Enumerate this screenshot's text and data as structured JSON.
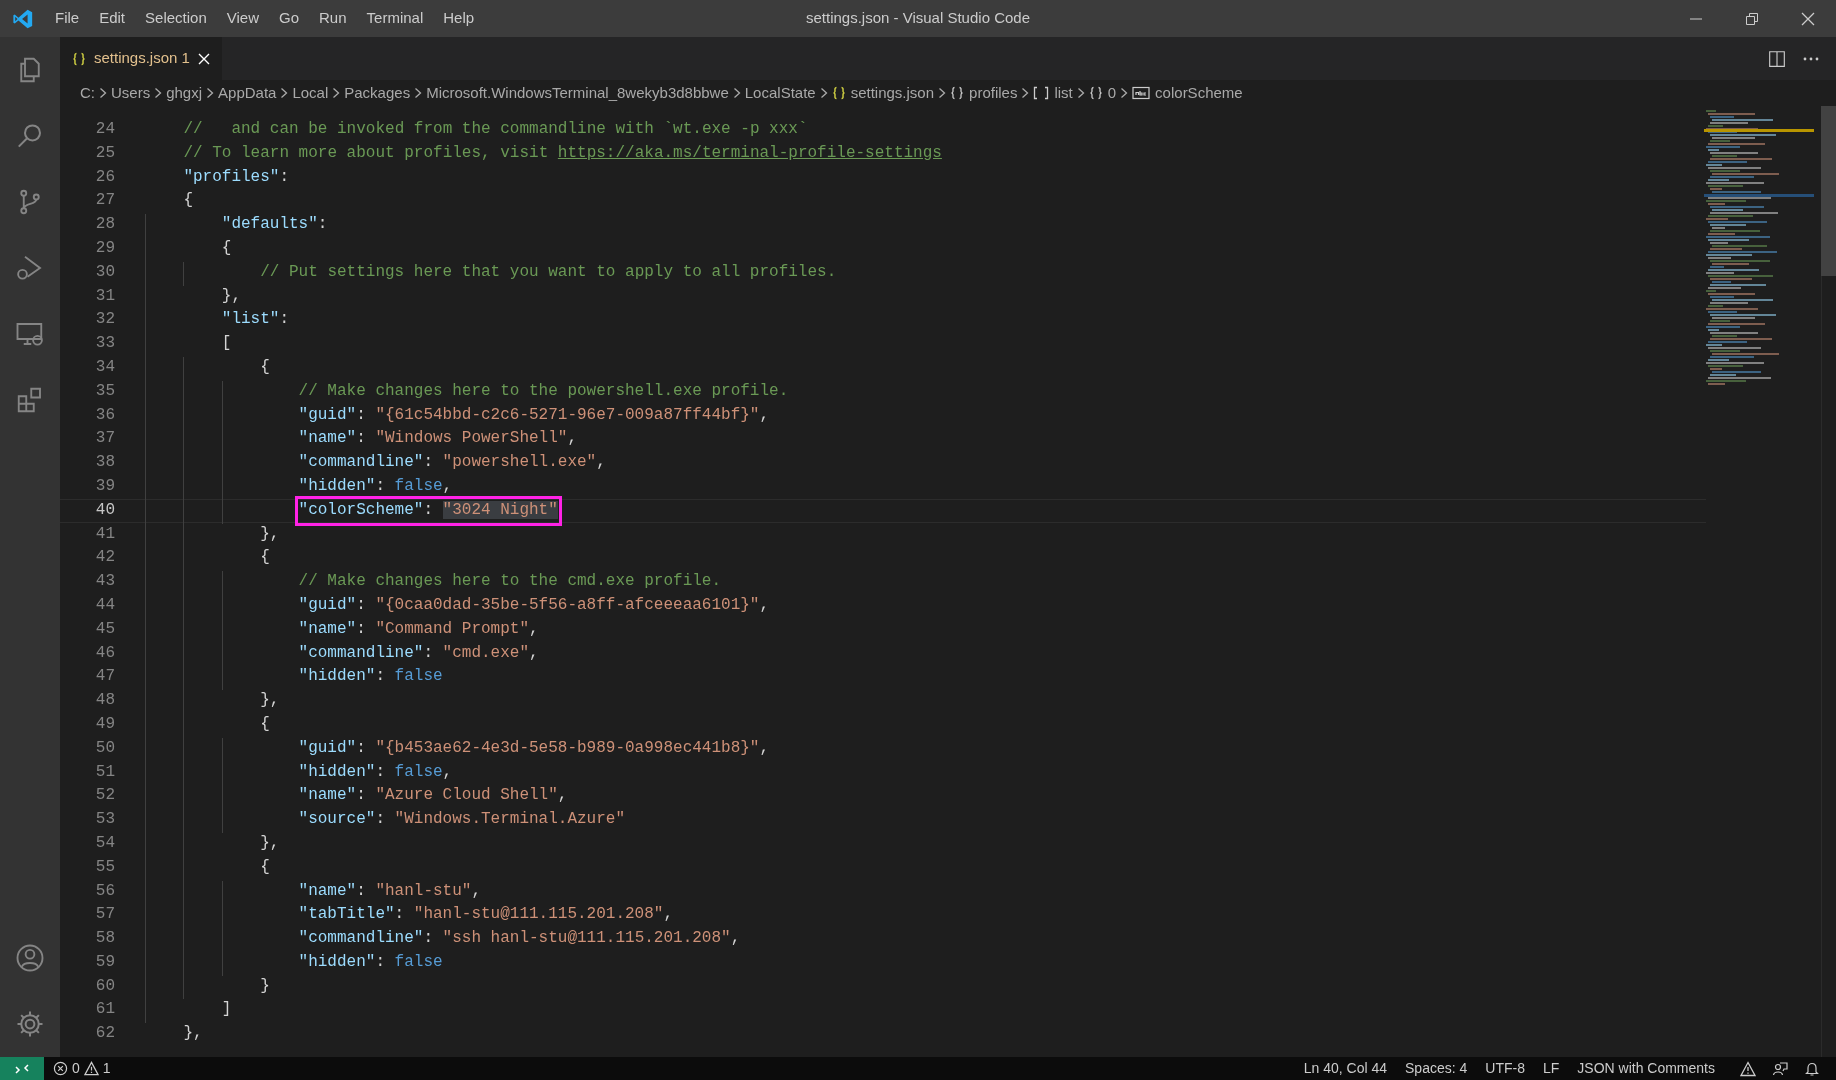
{
  "window": {
    "title": "settings.json - Visual Studio Code"
  },
  "menu": [
    "File",
    "Edit",
    "Selection",
    "View",
    "Go",
    "Run",
    "Terminal",
    "Help"
  ],
  "tabs": [
    {
      "label": "settings.json",
      "badge": "1",
      "selected": true
    }
  ],
  "breadcrumb": [
    {
      "label": "C:",
      "kind": "text"
    },
    {
      "label": "Users",
      "kind": "text"
    },
    {
      "label": "ghgxj",
      "kind": "text"
    },
    {
      "label": "AppData",
      "kind": "text"
    },
    {
      "label": "Local",
      "kind": "text"
    },
    {
      "label": "Packages",
      "kind": "text"
    },
    {
      "label": "Microsoft.WindowsTerminal_8wekyb3d8bbwe",
      "kind": "text"
    },
    {
      "label": "LocalState",
      "kind": "text"
    },
    {
      "label": "settings.json",
      "kind": "file"
    },
    {
      "label": "profiles",
      "kind": "object"
    },
    {
      "label": "list",
      "kind": "array"
    },
    {
      "label": "0",
      "kind": "object"
    },
    {
      "label": "colorScheme",
      "kind": "string"
    }
  ],
  "editor": {
    "lines": [
      {
        "number": "24",
        "current": false,
        "boxed": false,
        "tokens": [
          {
            "kind": "comment",
            "text": "    //   and can be invoked from the commandline with `wt.exe -p xxx`"
          }
        ]
      },
      {
        "number": "25",
        "current": false,
        "boxed": false,
        "tokens": [
          {
            "kind": "comment",
            "text": "    // To learn more about profiles, visit "
          },
          {
            "kind": "link",
            "text": "https://aka.ms/terminal-profile-settings"
          }
        ]
      },
      {
        "number": "26",
        "current": false,
        "boxed": false,
        "tokens": [
          {
            "kind": "key",
            "text": "    \"profiles\""
          },
          {
            "kind": "punct",
            "text": ":"
          }
        ]
      },
      {
        "number": "27",
        "current": false,
        "boxed": false,
        "tokens": [
          {
            "kind": "punct",
            "text": "    {"
          }
        ]
      },
      {
        "number": "28",
        "current": false,
        "boxed": false,
        "tokens": [
          {
            "kind": "key",
            "text": "        \"defaults\""
          },
          {
            "kind": "punct",
            "text": ":"
          }
        ]
      },
      {
        "number": "29",
        "current": false,
        "boxed": false,
        "tokens": [
          {
            "kind": "punct",
            "text": "        {"
          }
        ]
      },
      {
        "number": "30",
        "current": false,
        "boxed": false,
        "tokens": [
          {
            "kind": "comment",
            "text": "            // Put settings here that you want to apply to all profiles."
          }
        ]
      },
      {
        "number": "31",
        "current": false,
        "boxed": false,
        "tokens": [
          {
            "kind": "punct",
            "text": "        },"
          }
        ]
      },
      {
        "number": "32",
        "current": false,
        "boxed": false,
        "tokens": [
          {
            "kind": "key",
            "text": "        \"list\""
          },
          {
            "kind": "punct",
            "text": ":"
          }
        ]
      },
      {
        "number": "33",
        "current": false,
        "boxed": false,
        "tokens": [
          {
            "kind": "punct",
            "text": "        ["
          }
        ]
      },
      {
        "number": "34",
        "current": false,
        "boxed": false,
        "tokens": [
          {
            "kind": "punct",
            "text": "            {"
          }
        ]
      },
      {
        "number": "35",
        "current": false,
        "boxed": false,
        "tokens": [
          {
            "kind": "comment",
            "text": "                // Make changes here to the powershell.exe profile."
          }
        ]
      },
      {
        "number": "36",
        "current": false,
        "boxed": false,
        "tokens": [
          {
            "kind": "key",
            "text": "                \"guid\""
          },
          {
            "kind": "punct",
            "text": ": "
          },
          {
            "kind": "string",
            "text": "\"{61c54bbd-c2c6-5271-96e7-009a87ff44bf}\""
          },
          {
            "kind": "punct",
            "text": ","
          }
        ]
      },
      {
        "number": "37",
        "current": false,
        "boxed": false,
        "tokens": [
          {
            "kind": "key",
            "text": "                \"name\""
          },
          {
            "kind": "punct",
            "text": ": "
          },
          {
            "kind": "string",
            "text": "\"Windows PowerShell\""
          },
          {
            "kind": "punct",
            "text": ","
          }
        ]
      },
      {
        "number": "38",
        "current": false,
        "boxed": false,
        "tokens": [
          {
            "kind": "key",
            "text": "                \"commandline\""
          },
          {
            "kind": "punct",
            "text": ": "
          },
          {
            "kind": "string",
            "text": "\"powershell.exe\""
          },
          {
            "kind": "punct",
            "text": ","
          }
        ]
      },
      {
        "number": "39",
        "current": false,
        "boxed": false,
        "tokens": [
          {
            "kind": "key",
            "text": "                \"hidden\""
          },
          {
            "kind": "punct",
            "text": ": "
          },
          {
            "kind": "bool",
            "text": "false"
          },
          {
            "kind": "punct",
            "text": ","
          }
        ]
      },
      {
        "number": "40",
        "current": true,
        "boxed": true,
        "tokens": [
          {
            "kind": "key",
            "text": "                \"colorScheme\""
          },
          {
            "kind": "punct",
            "text": ": "
          },
          {
            "kind": "string-selected",
            "text": "\"3024 Night\""
          }
        ]
      },
      {
        "number": "41",
        "current": false,
        "boxed": false,
        "tokens": [
          {
            "kind": "punct",
            "text": "            },"
          }
        ]
      },
      {
        "number": "42",
        "current": false,
        "boxed": false,
        "tokens": [
          {
            "kind": "punct",
            "text": "            {"
          }
        ]
      },
      {
        "number": "43",
        "current": false,
        "boxed": false,
        "tokens": [
          {
            "kind": "comment",
            "text": "                // Make changes here to the cmd.exe profile."
          }
        ]
      },
      {
        "number": "44",
        "current": false,
        "boxed": false,
        "tokens": [
          {
            "kind": "key",
            "text": "                \"guid\""
          },
          {
            "kind": "punct",
            "text": ": "
          },
          {
            "kind": "string",
            "text": "\"{0caa0dad-35be-5f56-a8ff-afceeeaa6101}\""
          },
          {
            "kind": "punct",
            "text": ","
          }
        ]
      },
      {
        "number": "45",
        "current": false,
        "boxed": false,
        "tokens": [
          {
            "kind": "key",
            "text": "                \"name\""
          },
          {
            "kind": "punct",
            "text": ": "
          },
          {
            "kind": "string",
            "text": "\"Command Prompt\""
          },
          {
            "kind": "punct",
            "text": ","
          }
        ]
      },
      {
        "number": "46",
        "current": false,
        "boxed": false,
        "tokens": [
          {
            "kind": "key",
            "text": "                \"commandline\""
          },
          {
            "kind": "punct",
            "text": ": "
          },
          {
            "kind": "string",
            "text": "\"cmd.exe\""
          },
          {
            "kind": "punct",
            "text": ","
          }
        ]
      },
      {
        "number": "47",
        "current": false,
        "boxed": false,
        "tokens": [
          {
            "kind": "key",
            "text": "                \"hidden\""
          },
          {
            "kind": "punct",
            "text": ": "
          },
          {
            "kind": "bool",
            "text": "false"
          }
        ]
      },
      {
        "number": "48",
        "current": false,
        "boxed": false,
        "tokens": [
          {
            "kind": "punct",
            "text": "            },"
          }
        ]
      },
      {
        "number": "49",
        "current": false,
        "boxed": false,
        "tokens": [
          {
            "kind": "punct",
            "text": "            {"
          }
        ]
      },
      {
        "number": "50",
        "current": false,
        "boxed": false,
        "tokens": [
          {
            "kind": "key",
            "text": "                \"guid\""
          },
          {
            "kind": "punct",
            "text": ": "
          },
          {
            "kind": "string",
            "text": "\"{b453ae62-4e3d-5e58-b989-0a998ec441b8}\""
          },
          {
            "kind": "punct",
            "text": ","
          }
        ]
      },
      {
        "number": "51",
        "current": false,
        "boxed": false,
        "tokens": [
          {
            "kind": "key",
            "text": "                \"hidden\""
          },
          {
            "kind": "punct",
            "text": ": "
          },
          {
            "kind": "bool",
            "text": "false"
          },
          {
            "kind": "punct",
            "text": ","
          }
        ]
      },
      {
        "number": "52",
        "current": false,
        "boxed": false,
        "tokens": [
          {
            "kind": "key",
            "text": "                \"name\""
          },
          {
            "kind": "punct",
            "text": ": "
          },
          {
            "kind": "string",
            "text": "\"Azure Cloud Shell\""
          },
          {
            "kind": "punct",
            "text": ","
          }
        ]
      },
      {
        "number": "53",
        "current": false,
        "boxed": false,
        "tokens": [
          {
            "kind": "key",
            "text": "                \"source\""
          },
          {
            "kind": "punct",
            "text": ": "
          },
          {
            "kind": "string",
            "text": "\"Windows.Terminal.Azure\""
          }
        ]
      },
      {
        "number": "54",
        "current": false,
        "boxed": false,
        "tokens": [
          {
            "kind": "punct",
            "text": "            },"
          }
        ]
      },
      {
        "number": "55",
        "current": false,
        "boxed": false,
        "tokens": [
          {
            "kind": "punct",
            "text": "            {"
          }
        ]
      },
      {
        "number": "56",
        "current": false,
        "boxed": false,
        "tokens": [
          {
            "kind": "key",
            "text": "                \"name\""
          },
          {
            "kind": "punct",
            "text": ": "
          },
          {
            "kind": "string",
            "text": "\"hanl-stu\""
          },
          {
            "kind": "punct",
            "text": ","
          }
        ]
      },
      {
        "number": "57",
        "current": false,
        "boxed": false,
        "tokens": [
          {
            "kind": "key",
            "text": "                \"tabTitle\""
          },
          {
            "kind": "punct",
            "text": ": "
          },
          {
            "kind": "string",
            "text": "\"hanl-stu@111.115.201.208\""
          },
          {
            "kind": "punct",
            "text": ","
          }
        ]
      },
      {
        "number": "58",
        "current": false,
        "boxed": false,
        "tokens": [
          {
            "kind": "key",
            "text": "                \"commandline\""
          },
          {
            "kind": "punct",
            "text": ": "
          },
          {
            "kind": "string",
            "text": "\"ssh hanl-stu@111.115.201.208\""
          },
          {
            "kind": "punct",
            "text": ","
          }
        ]
      },
      {
        "number": "59",
        "current": false,
        "boxed": false,
        "tokens": [
          {
            "kind": "key",
            "text": "                \"hidden\""
          },
          {
            "kind": "punct",
            "text": ": "
          },
          {
            "kind": "bool",
            "text": "false"
          }
        ]
      },
      {
        "number": "60",
        "current": false,
        "boxed": false,
        "tokens": [
          {
            "kind": "punct",
            "text": "            }"
          }
        ]
      },
      {
        "number": "61",
        "current": false,
        "boxed": false,
        "tokens": [
          {
            "kind": "punct",
            "text": "        ]"
          }
        ]
      },
      {
        "number": "62",
        "current": false,
        "boxed": false,
        "tokens": [
          {
            "kind": "punct",
            "text": "    },"
          }
        ]
      }
    ]
  },
  "status_bar": {
    "errors": "0",
    "warnings": "1",
    "items": [
      "Ln 40, Col 44",
      "Spaces: 4",
      "UTF-8",
      "LF",
      "JSON with Comments"
    ]
  }
}
